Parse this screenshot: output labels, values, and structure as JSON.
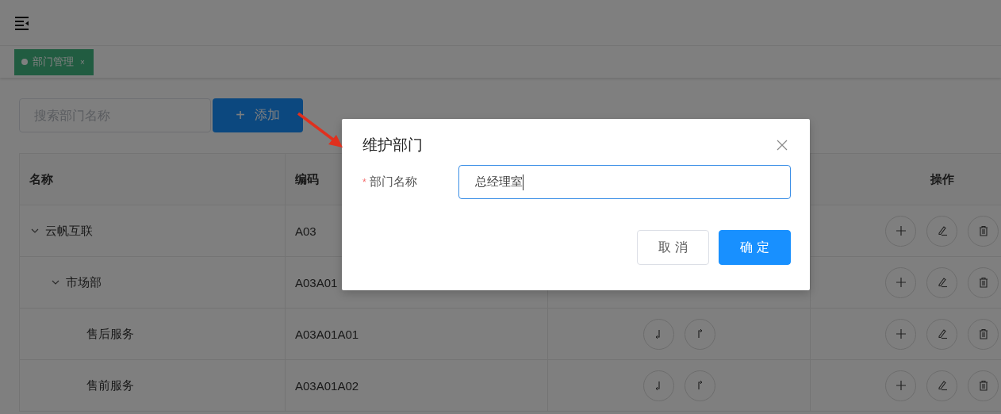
{
  "tabs": [
    {
      "label": "部门管理",
      "selected": true,
      "close": "×"
    }
  ],
  "toolbar": {
    "search": {
      "placeholder": "搜索部门名称"
    },
    "add_button": {
      "icon": "+",
      "label": "添加"
    }
  },
  "table": {
    "columns": [
      {
        "kind": "name",
        "label": "名称"
      },
      {
        "kind": "code",
        "label": "编码"
      },
      {
        "kind": "sort"
      },
      {
        "kind": "actions",
        "label": "操作"
      }
    ],
    "rows": [
      {
        "name": "云帆互联",
        "code": "A03",
        "expanded": true,
        "children": [
          {
            "name": "市场部",
            "code": "A03A01",
            "expanded": true,
            "children": [
              {
                "name": "售后服务",
                "code": "A03A01A01",
                "sort_shown": true
              },
              {
                "name": "售前服务",
                "code": "A03A01A02",
                "sort_shown": true
              }
            ]
          }
        ]
      }
    ]
  },
  "dialog": {
    "title": "维护部门",
    "field": {
      "label": "部门名称",
      "required_mark": "*",
      "value": "总经理室",
      "focused": true
    },
    "buttons": [
      {
        "kind": "secondary",
        "label": "取 消"
      },
      {
        "kind": "primary",
        "label": "确 定"
      }
    ]
  },
  "annotation": {
    "kind": "arrow",
    "color": "#e0301e"
  }
}
